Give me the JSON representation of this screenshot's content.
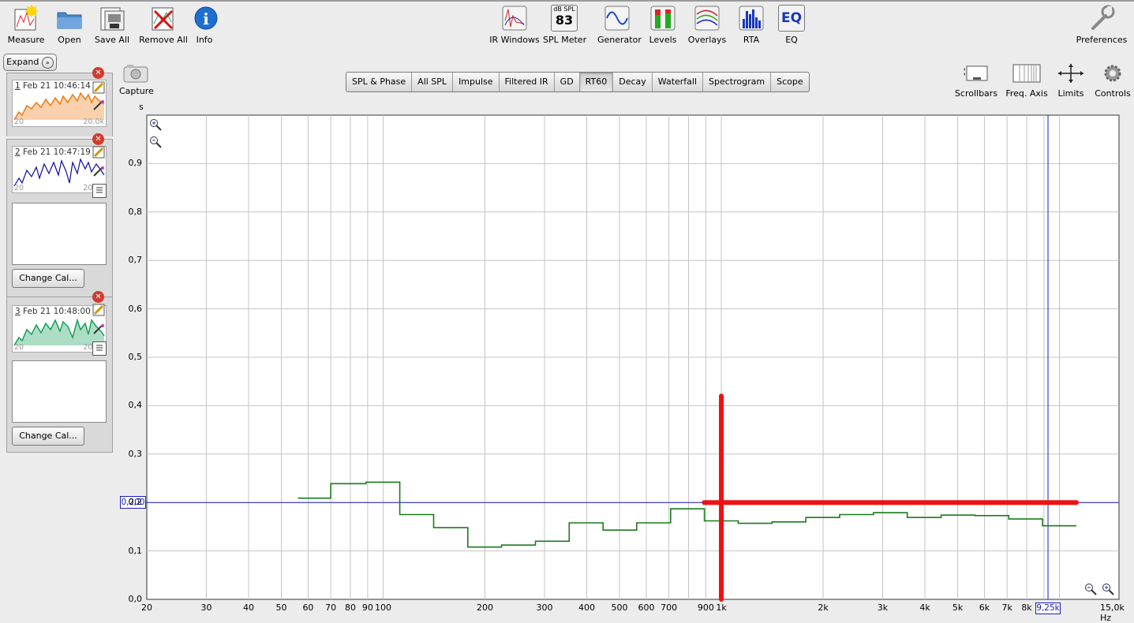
{
  "toolbar_left": [
    {
      "label": "Measure",
      "icon": "measure-icon"
    },
    {
      "label": "Open",
      "icon": "folder-icon"
    },
    {
      "label": "Save All",
      "icon": "save-all-icon"
    },
    {
      "label": "Remove All",
      "icon": "remove-all-icon"
    },
    {
      "label": "Info",
      "icon": "info-icon"
    }
  ],
  "toolbar_center": [
    {
      "label": "IR Windows",
      "icon": "ir-windows-icon"
    },
    {
      "label": "SPL Meter",
      "icon": "spl-meter-icon",
      "meter_unit": "dB SPL",
      "meter_value": "83"
    },
    {
      "label": "Generator",
      "icon": "generator-icon"
    },
    {
      "label": "Levels",
      "icon": "levels-icon"
    },
    {
      "label": "Overlays",
      "icon": "overlays-icon"
    },
    {
      "label": "RTA",
      "icon": "rta-icon"
    },
    {
      "label": "EQ",
      "icon": "eq-icon",
      "icon_text": "EQ"
    }
  ],
  "preferences_label": "Preferences",
  "capture_label": "Capture",
  "graph_controls": [
    {
      "label": "Scrollbars"
    },
    {
      "label": "Freq. Axis"
    },
    {
      "label": "Limits"
    },
    {
      "label": "Controls"
    }
  ],
  "tabs": [
    "SPL & Phase",
    "All SPL",
    "Impulse",
    "Filtered IR",
    "GD",
    "RT60",
    "Decay",
    "Waterfall",
    "Spectrogram",
    "Scope"
  ],
  "active_tab": "RT60",
  "expand_label": "Expand",
  "measurements": [
    {
      "num": "1",
      "title": "Feb 21 10:46:14",
      "color": "#f07a10",
      "f_min": "20",
      "f_max": "20,0k"
    },
    {
      "num": "2",
      "title": "Feb 21 10:47:19",
      "color": "#0c0c9c",
      "f_min": "20",
      "f_max": "20,0k",
      "button": "Change Cal..."
    },
    {
      "num": "3",
      "title": "Feb 21 10:48:00",
      "color": "#15a05a",
      "f_min": "20",
      "f_max": "20,0k",
      "button": "Change Cal..."
    }
  ],
  "colors": {
    "rt60_line": "#1a7a1a",
    "cursor": "#1c1cbe",
    "annotation": "#ee1111",
    "grid": "#c4c4c4"
  },
  "chart_data": {
    "type": "line",
    "title": "",
    "ylabel": "s",
    "xunit": "Hz",
    "xscale": "log",
    "xlim": [
      20,
      15000
    ],
    "ylim": [
      0,
      1.0
    ],
    "y_ticks": [
      "0,0",
      "0,1",
      "0,2",
      "0,3",
      "0,4",
      "0,5",
      "0,6",
      "0,7",
      "0,8",
      "0,9"
    ],
    "x_ticks": [
      "20",
      "30",
      "40",
      "50",
      "60",
      "70",
      "80",
      "90",
      "100",
      "200",
      "300",
      "400",
      "500",
      "600",
      "700",
      "900",
      "1k",
      "2k",
      "3k",
      "4k",
      "5k",
      "6k",
      "7k",
      "8k"
    ],
    "x_end_label": "15,0k Hz",
    "cursor_x_label": "9,25k",
    "cursor_x_value": 9250,
    "cursor_y_label": "0,200",
    "cursor_y_value": 0.2,
    "series": [
      {
        "style": "step",
        "bands": [
          {
            "from": 56,
            "to": 70,
            "value": 0.209
          },
          {
            "from": 70,
            "to": 89,
            "value": 0.239
          },
          {
            "from": 89,
            "to": 112,
            "value": 0.242
          },
          {
            "from": 112,
            "to": 141,
            "value": 0.175
          },
          {
            "from": 141,
            "to": 178,
            "value": 0.148
          },
          {
            "from": 178,
            "to": 224,
            "value": 0.108
          },
          {
            "from": 224,
            "to": 282,
            "value": 0.112
          },
          {
            "from": 282,
            "to": 355,
            "value": 0.12
          },
          {
            "from": 355,
            "to": 447,
            "value": 0.158
          },
          {
            "from": 447,
            "to": 562,
            "value": 0.143
          },
          {
            "from": 562,
            "to": 708,
            "value": 0.158
          },
          {
            "from": 708,
            "to": 891,
            "value": 0.187
          },
          {
            "from": 891,
            "to": 1122,
            "value": 0.162
          },
          {
            "from": 1122,
            "to": 1413,
            "value": 0.157
          },
          {
            "from": 1413,
            "to": 1778,
            "value": 0.16
          },
          {
            "from": 1778,
            "to": 2239,
            "value": 0.169
          },
          {
            "from": 2239,
            "to": 2818,
            "value": 0.175
          },
          {
            "from": 2818,
            "to": 3548,
            "value": 0.179
          },
          {
            "from": 3548,
            "to": 4467,
            "value": 0.169
          },
          {
            "from": 4467,
            "to": 5623,
            "value": 0.174
          },
          {
            "from": 5623,
            "to": 7079,
            "value": 0.173
          },
          {
            "from": 7079,
            "to": 8913,
            "value": 0.166
          },
          {
            "from": 8913,
            "to": 11220,
            "value": 0.152
          }
        ]
      }
    ],
    "annotations": {
      "vertical_at_hz": 1000,
      "vertical_y_range": [
        0,
        0.42
      ],
      "horizontal_at": 0.2,
      "horizontal_x_range": [
        890,
        11220
      ]
    },
    "grid": true
  }
}
